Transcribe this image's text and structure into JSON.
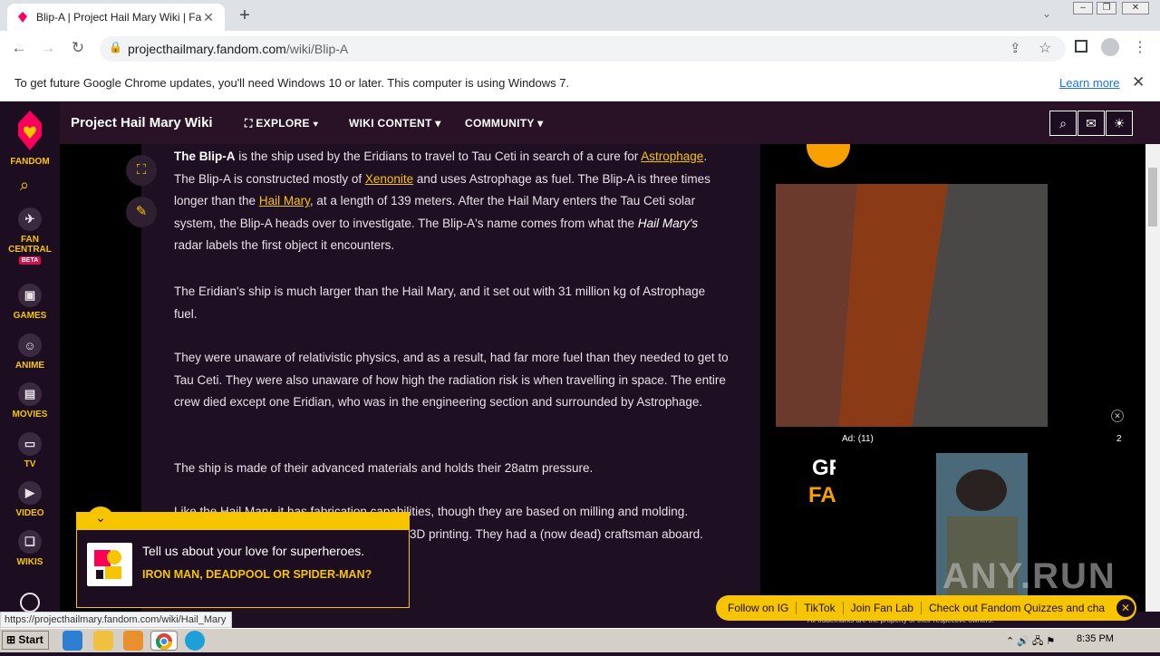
{
  "browser": {
    "tab_title": "Blip-A | Project Hail Mary Wiki | Fand",
    "url_host": "projecthailmary.fandom.com",
    "url_path": "/wiki/Blip-A",
    "info_text": "To get future Google Chrome updates, you'll need Windows 10 or later. This computer is using Windows 7.",
    "info_link": "Learn more"
  },
  "sidebar": {
    "logo_label": "FANDOM",
    "items": [
      {
        "label": "FAN CENTRAL",
        "badge": "BETA"
      },
      {
        "label": "GAMES"
      },
      {
        "label": "ANIME"
      },
      {
        "label": "MOVIES"
      },
      {
        "label": "TV"
      },
      {
        "label": "VIDEO"
      },
      {
        "label": "WIKIS"
      }
    ]
  },
  "header": {
    "wiki_title": "Project Hail Mary Wiki",
    "nav": [
      "EXPLORE",
      "WIKI CONTENT",
      "COMMUNITY"
    ]
  },
  "article": {
    "p1_lead": "The Blip-A",
    "p1_a": " is the ship used by the Eridians to travel to Tau Ceti in search of a cure for ",
    "p1_link1": "Astrophage",
    "p1_b": ". The Blip-A is constructed mostly of ",
    "p1_link2": "Xenonite",
    "p1_c": " and uses Astrophage as fuel. The Blip-A is three times longer than the ",
    "p1_link3": "Hail Mary",
    "p1_d": ", at a length of 139 meters. After the Hail Mary enters the Tau Ceti solar system, the Blip-A heads over to investigate. The Blip-A's name comes from what the ",
    "p1_em": "Hail Mary's",
    "p1_e": " radar labels the first object it encounters.",
    "p2": "The Eridian's ship is much larger than the Hail Mary, and it set out with 31 million kg of Astrophage fuel.",
    "p3": "They were unaware of relativistic physics, and as a result, had far more fuel than they needed to get to Tau Ceti. They were also unaware of how high the radiation risk is when travelling in space. The entire crew died except one Eridian, who was in the engineering section and surrounded by Astrophage.",
    "p4": "The ship is made of their advanced materials and holds their 28atm pressure.",
    "p5a": "Like the Hail Mary, it has fabrication capabilities, though they are based on milling and molding.",
    "p5b": "3D printing. They had a (now dead) craftsman aboard."
  },
  "ads": {
    "ad_label": "Ad: (11)",
    "ad_count": "2",
    "gr_text1": "GR",
    "gr_text2": "FA",
    "footer": "All trademarks are the property of their respective owners."
  },
  "popup": {
    "question": "Tell us about your love for superheroes.",
    "answer": "IRON MAN, DEADPOOL OR SPIDER-MAN?"
  },
  "banner": [
    "Follow on IG",
    "TikTok",
    "Join Fan Lab",
    "Check out Fandom Quizzes and cha"
  ],
  "status_url": "https://projecthailmary.fandom.com/wiki/Hail_Mary",
  "taskbar": {
    "start": "Start",
    "clock": "8:35 PM"
  },
  "watermark": "ANY.RUN",
  "colors": {
    "accent": "#f7c500",
    "fandom_pink": "#fa005a",
    "bg": "#1f0f22"
  }
}
